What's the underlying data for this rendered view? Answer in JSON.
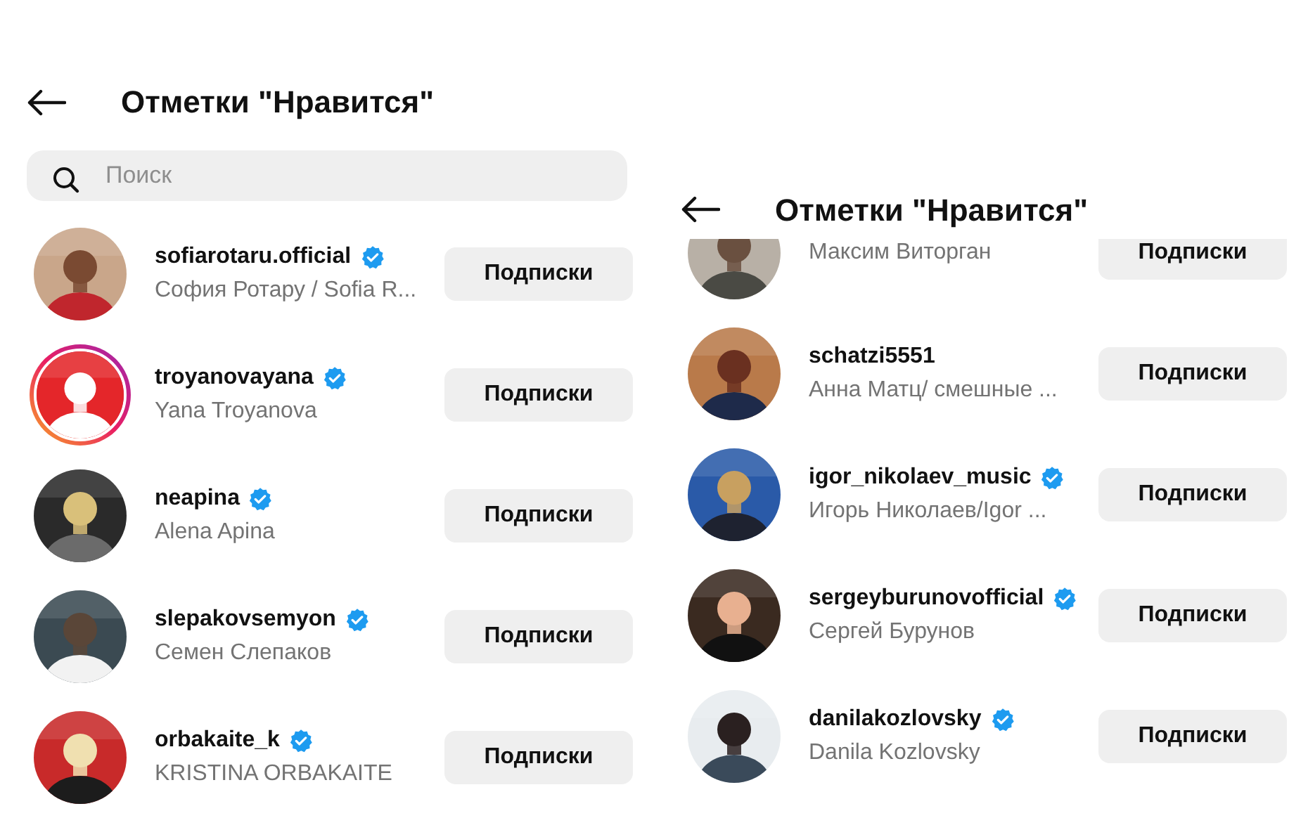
{
  "panels": [
    {
      "header": {
        "title": "Отметки \"Нравится\""
      },
      "search": {
        "placeholder": "Поиск"
      },
      "users": [
        {
          "username": "sofiarotaru.official",
          "verified": true,
          "name": "София Ротару / Sofia R...",
          "button": "Подписки"
        },
        {
          "username": "troyanovayana",
          "verified": true,
          "name": "Yana Troyanova",
          "button": "Подписки",
          "story_ring": true
        },
        {
          "username": "neapina",
          "verified": true,
          "name": "Alena Apina",
          "button": "Подписки"
        },
        {
          "username": "slepakovsemyon",
          "verified": true,
          "name": "Семен Слепаков",
          "button": "Подписки"
        },
        {
          "username": "orbakaite_k",
          "verified": true,
          "name": "KRISTINA ORBAKAITE",
          "button": "Подписки"
        }
      ]
    },
    {
      "header": {
        "title": "Отметки \"Нравится\""
      },
      "users": [
        {
          "name": "Максим Виторган",
          "button": "Подписки"
        },
        {
          "username": "schatzi5551",
          "verified": false,
          "name": "Анна Матц/ смешные ...",
          "button": "Подписки"
        },
        {
          "username": "igor_nikolaev_music",
          "verified": true,
          "name": "Игорь Николаев/Igor ...",
          "button": "Подписки"
        },
        {
          "username": "sergeyburunovofficial",
          "verified": true,
          "name": "Сергей Бурунов",
          "button": "Подписки"
        },
        {
          "username": "danilakozlovsky",
          "verified": true,
          "name": "Danila Kozlovsky",
          "button": "Подписки"
        }
      ]
    }
  ]
}
